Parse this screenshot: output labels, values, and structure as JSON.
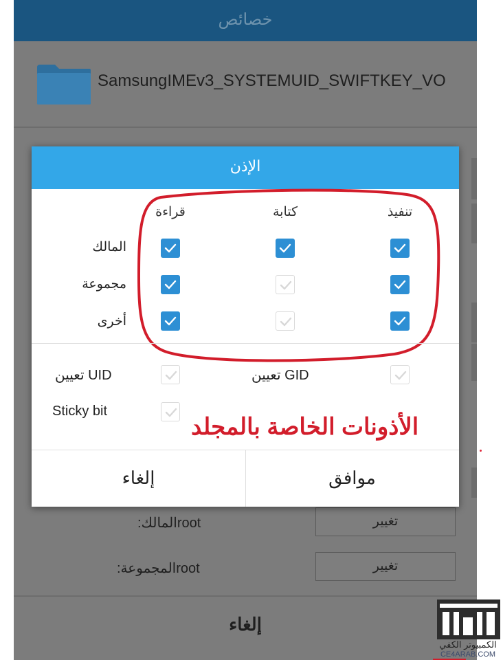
{
  "background_dialog": {
    "title": "خصائص",
    "folder_name": "SamsungIMEv3_SYSTEMUID_SWIFTKEY_VO",
    "owner_label": "rootالمالك:",
    "group_label": "rootالمجموعة:",
    "change_button": "تغيير",
    "cancel_button": "إلغاء"
  },
  "permission_dialog": {
    "title": "الإذن",
    "columns": [
      "قراءة",
      "كتابة",
      "تنفيذ"
    ],
    "rows": [
      {
        "label": "المالك",
        "read": true,
        "write": true,
        "execute": true
      },
      {
        "label": "مجموعة",
        "read": true,
        "write": false,
        "execute": true
      },
      {
        "label": "أخرى",
        "read": true,
        "write": false,
        "execute": true
      }
    ],
    "set_uid_label": "تعيين UID",
    "set_gid_label": "تعيين GID",
    "sticky_bit_label": "Sticky bit",
    "set_uid": false,
    "set_gid": false,
    "sticky_bit": false,
    "cancel_button": "إلغاء",
    "ok_button": "موافق"
  },
  "annotation": "الأذونات الخاصة بالمجلد",
  "watermark": {
    "line1": "الكمبيوتر الكفي",
    "line2": "CE4ARAB.COM"
  },
  "colors": {
    "header_blue": "#33a7e8",
    "checkbox_blue": "#2d8fd4",
    "annotation_red": "#d21d2b"
  }
}
